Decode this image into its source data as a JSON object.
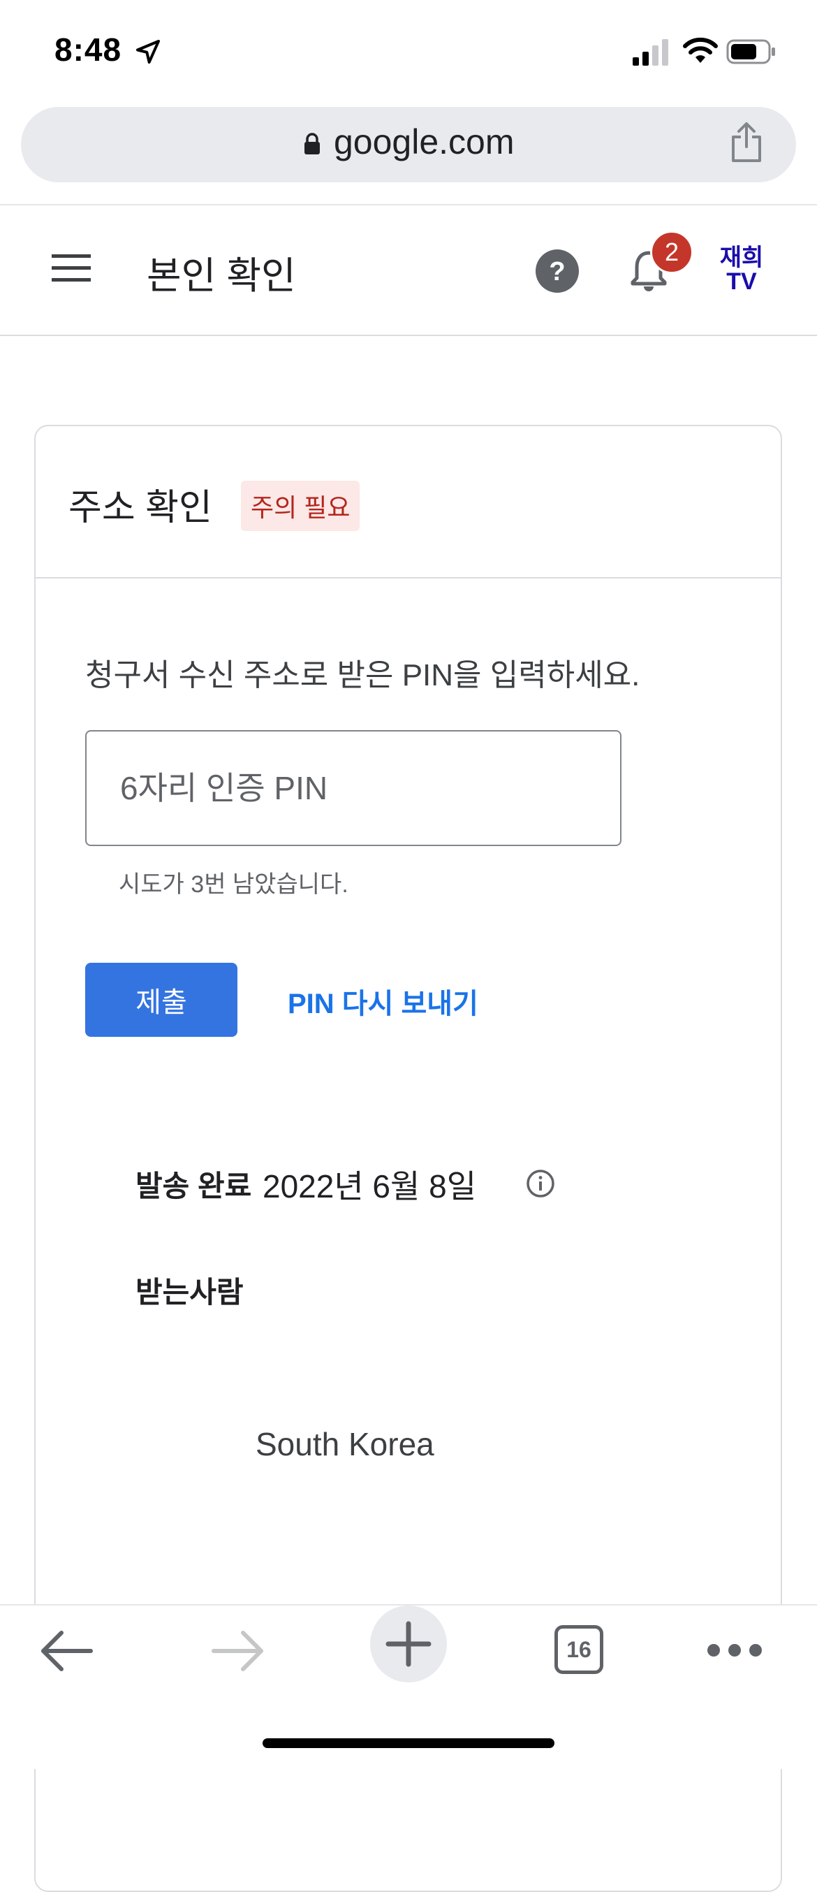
{
  "status_bar": {
    "time": "8:48"
  },
  "browser": {
    "url": "google.com",
    "tab_count": "16"
  },
  "header": {
    "title": "본인 확인",
    "notification_count": "2",
    "avatar_text_line1": "재희",
    "avatar_text_line2": "TV"
  },
  "card": {
    "title": "주소 확인",
    "status_badge": "주의 필요",
    "instruction": "청구서 수신 주소로 받은 PIN을 입력하세요.",
    "pin_placeholder": "6자리 인증 PIN",
    "attempts_helper": "시도가 3번 남았습니다.",
    "submit_label": "제출",
    "resend_label": "PIN 다시 보내기",
    "sent_label": "발송 완료",
    "sent_date": "2022년 6월 8일",
    "recipient_label": "받는사람",
    "country": "South Korea"
  },
  "colors": {
    "accent": "#3474e0",
    "link": "#1a73e8",
    "badge_red": "#c5362a",
    "attention_bg": "#fce8e6",
    "attention_text": "#b3261e"
  },
  "icons": [
    "location-arrow-icon",
    "signal-icon",
    "wifi-icon",
    "battery-icon",
    "lock-icon",
    "share-icon",
    "menu-icon",
    "help-icon",
    "bell-icon",
    "info-icon",
    "back-icon",
    "forward-icon",
    "plus-icon",
    "more-icon"
  ]
}
